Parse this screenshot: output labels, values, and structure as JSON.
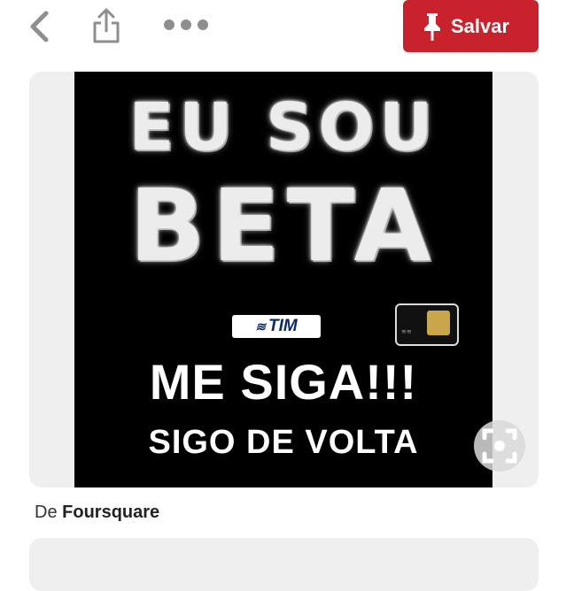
{
  "toolbar": {
    "back_icon": "chevron-left-icon",
    "share_icon": "share-icon",
    "more_icon": "more-dots-icon",
    "save_label": "Salvar",
    "save_icon": "pin-icon",
    "save_color": "#c8232c"
  },
  "pin": {
    "image_text": {
      "line1": "EU SOU",
      "line2": "BETA",
      "brand": "TIM",
      "line3": "ME SIGA!!!",
      "line4": "SIGO DE VOLTA"
    },
    "zoom_icon": "visual-search-icon"
  },
  "source": {
    "prefix": "De",
    "name": "Foursquare"
  }
}
